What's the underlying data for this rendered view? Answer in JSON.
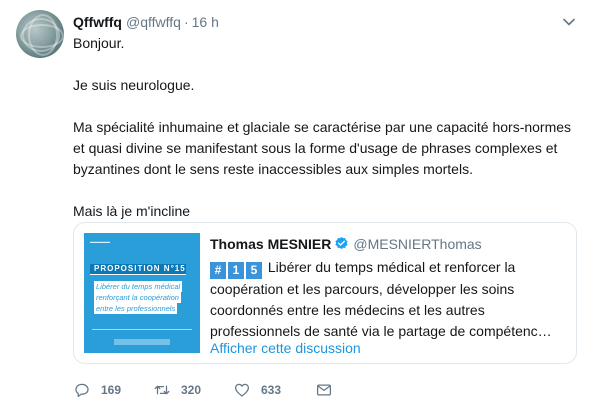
{
  "tweet": {
    "author_name": "Qffwffq",
    "handle": "@qffwffq",
    "separator": "·",
    "time": "16 h",
    "paragraphs": [
      "Bonjour.",
      "Je suis neurologue.",
      "Ma spécialité inhumaine et glaciale se caractérise par une capacité hors-normes et quasi divine se manifestant sous la forme d'usage de phrases complexes et byzantines dont le sens reste inaccessibles aux simples mortels.",
      "Mais là je m'incline"
    ]
  },
  "quoted": {
    "author_name": "Thomas MESNIER",
    "handle": "@MESNIERThomas",
    "badges": [
      "#",
      "1",
      "5"
    ],
    "text": "Libérer du temps médical et renforcer la coopération et les parcours, développer les soins coordonnés entre les médecins et les autres professionnels de santé via le partage de compétenc…",
    "show_thread_label": "Afficher cette discussion",
    "image": {
      "proposition_label": "PROPOSITION N°15",
      "lines": [
        "Libérer du temps médical",
        "renforçant la coopération",
        "entre les professionnels"
      ]
    }
  },
  "actions": {
    "reply_count": "169",
    "retweet_count": "320",
    "like_count": "633"
  },
  "colors": {
    "accent": "#1b95e0",
    "muted": "#657786",
    "image_bg": "#2a9ed9"
  },
  "icons": [
    "reply-icon",
    "retweet-icon",
    "heart-icon",
    "envelope-icon",
    "chevron-down-icon",
    "verified-badge-icon"
  ]
}
